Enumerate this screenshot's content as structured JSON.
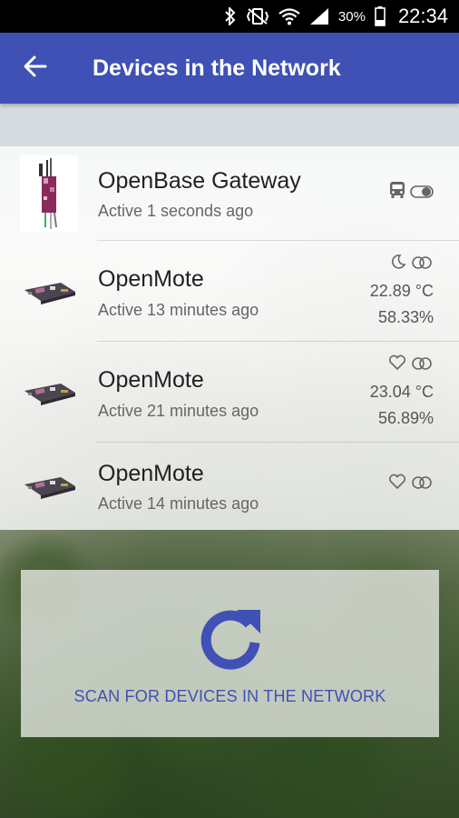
{
  "status_bar": {
    "battery_percent": "30%",
    "time": "22:34",
    "icons": [
      "bluetooth-icon",
      "vibrate-icon",
      "wifi-icon",
      "signal-icon",
      "battery-icon"
    ]
  },
  "app_bar": {
    "title": "Devices in the Network",
    "back_icon": "arrow-back-icon",
    "color": "#3f51b5"
  },
  "devices": [
    {
      "name": "OpenBase Gateway",
      "active": "Active 1 seconds ago",
      "thumbnail": "gateway-board-image",
      "status_icons": [
        "bus-icon",
        "toggle-icon"
      ]
    },
    {
      "name": "OpenMote",
      "active": "Active 13 minutes ago",
      "thumbnail": "openmote-board-image",
      "status_icons": [
        "moon-icon",
        "rings-icon"
      ],
      "temperature": "22.89 °C",
      "humidity": "58.33%"
    },
    {
      "name": "OpenMote",
      "active": "Active 21 minutes ago",
      "thumbnail": "openmote-board-image",
      "status_icons": [
        "heart-icon",
        "rings-icon"
      ],
      "temperature": "23.04 °C",
      "humidity": "56.89%"
    },
    {
      "name": "OpenMote",
      "active": "Active 14 minutes ago",
      "thumbnail": "openmote-board-image",
      "status_icons": [
        "heart-icon",
        "rings-icon"
      ]
    }
  ],
  "scan": {
    "label": "SCAN FOR DEVICES IN THE NETWORK",
    "icon": "refresh-icon",
    "accent": "#3f51b5"
  }
}
